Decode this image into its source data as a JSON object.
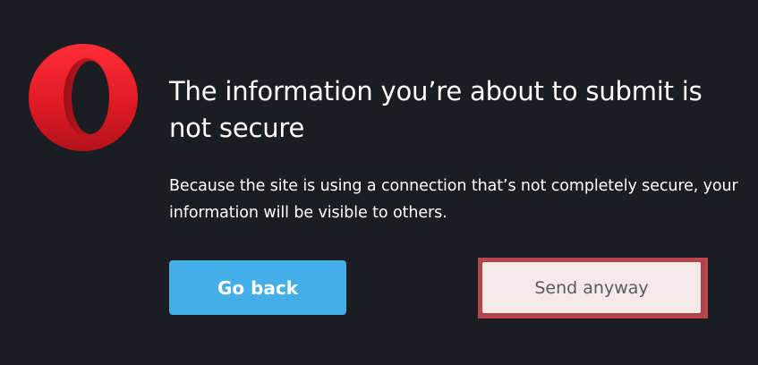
{
  "brand": {
    "logo_icon": "opera-logo-icon",
    "colors": {
      "logo_red": "#e8202a",
      "background": "#1b1d22",
      "primary_button": "#44aee6",
      "secondary_button": "#f4e8e9",
      "highlight_border": "#b8474d"
    }
  },
  "dialog": {
    "title": "The information you’re about to submit is not secure",
    "description": "Because the site is using a connection that’s not completely secure, your information will be visible to others."
  },
  "buttons": {
    "go_back_label": "Go back",
    "send_anyway_label": "Send anyway"
  }
}
